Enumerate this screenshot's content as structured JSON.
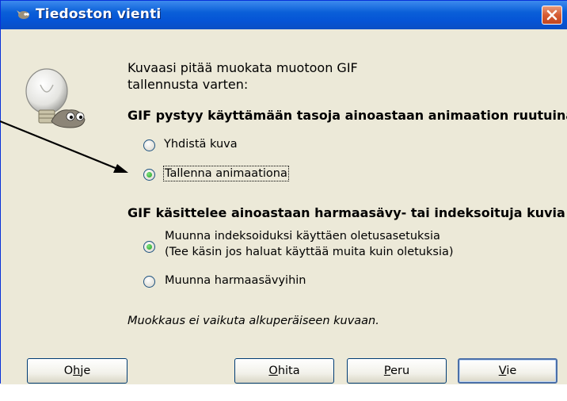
{
  "window": {
    "title": "Tiedoston vienti"
  },
  "intro": {
    "line1": "Kuvaasi pitää muokata muotoon GIF",
    "line2": "tallennusta varten:"
  },
  "section_layers": {
    "heading": "GIF pystyy käyttämään tasoja ainoastaan animaation ruutuina",
    "options": [
      {
        "label": "Yhdistä kuva",
        "checked": false
      },
      {
        "label": "Tallenna animaationa",
        "checked": true
      }
    ]
  },
  "section_color": {
    "heading": "GIF käsittelee ainoastaan harmaasävy- tai indeksoituja kuvia",
    "options": [
      {
        "label_line1": "Muunna indeksoiduksi käyttäen oletusasetuksia",
        "label_line2": "(Tee käsin jos haluat käyttää muita kuin oletuksia)",
        "checked": true
      },
      {
        "label": "Muunna harmaasävyihin",
        "checked": false
      }
    ]
  },
  "note": "Muokkaus ei vaikuta alkuperäiseen kuvaan.",
  "buttons": {
    "help": {
      "pre": "O",
      "accel": "h",
      "post": "je"
    },
    "ignore": {
      "pre": "",
      "accel": "O",
      "post": "hita"
    },
    "cancel": {
      "pre": "",
      "accel": "P",
      "post": "eru"
    },
    "export": {
      "pre": "",
      "accel": "V",
      "post": "ie"
    }
  },
  "colors": {
    "titlebar": "#0554d6",
    "dialog_bg": "#ece9d8",
    "radio_selected": "#21a121"
  }
}
